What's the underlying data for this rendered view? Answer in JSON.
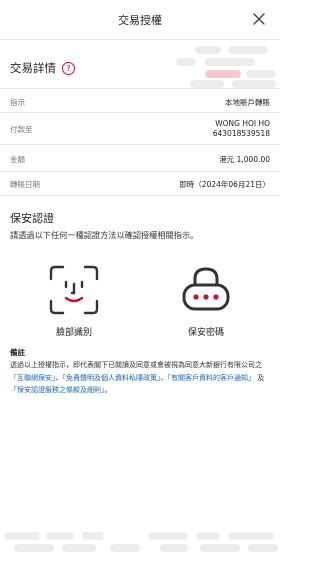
{
  "header": {
    "title": "交易授權"
  },
  "details": {
    "heading": "交易詳情",
    "rows": [
      {
        "label": "指示",
        "value": "本地賬戶轉賬"
      },
      {
        "label": "付款至",
        "value": "WONG HOI HO",
        "value2": "643018539518"
      },
      {
        "label": "金額",
        "value": "港元 1,000.00"
      },
      {
        "label": "轉賬日期",
        "value": "即時（2024年06月21日）"
      }
    ]
  },
  "auth": {
    "title": "保安認證",
    "subtitle": "請透過以下任何一種認證方法以確認授權相關指示。",
    "methods": [
      {
        "label": "臉部識別",
        "icon": "face-id-icon"
      },
      {
        "label": "保安密碼",
        "icon": "lock-pin-icon"
      }
    ]
  },
  "remarks": {
    "title": "備註",
    "text_1": "透過以上授權指示，即代表閣下已閱讀及同意或會被視為同意大新銀行有限公司之",
    "link_1": "「互聯網保安」",
    "sep_1": "、",
    "link_2": "「免責聲明及個人資料私隱政策」",
    "sep_2": "、",
    "link_3": "「有關客戶資料的客戶通知」",
    "sep_3": " 及 ",
    "link_4": "「保安認證服務之條款及細則」",
    "end": "。"
  },
  "colors": {
    "accent": "#c8102e",
    "link": "#1565c0",
    "pill": "#ececec",
    "pill_pink": "#f3c9cf"
  }
}
